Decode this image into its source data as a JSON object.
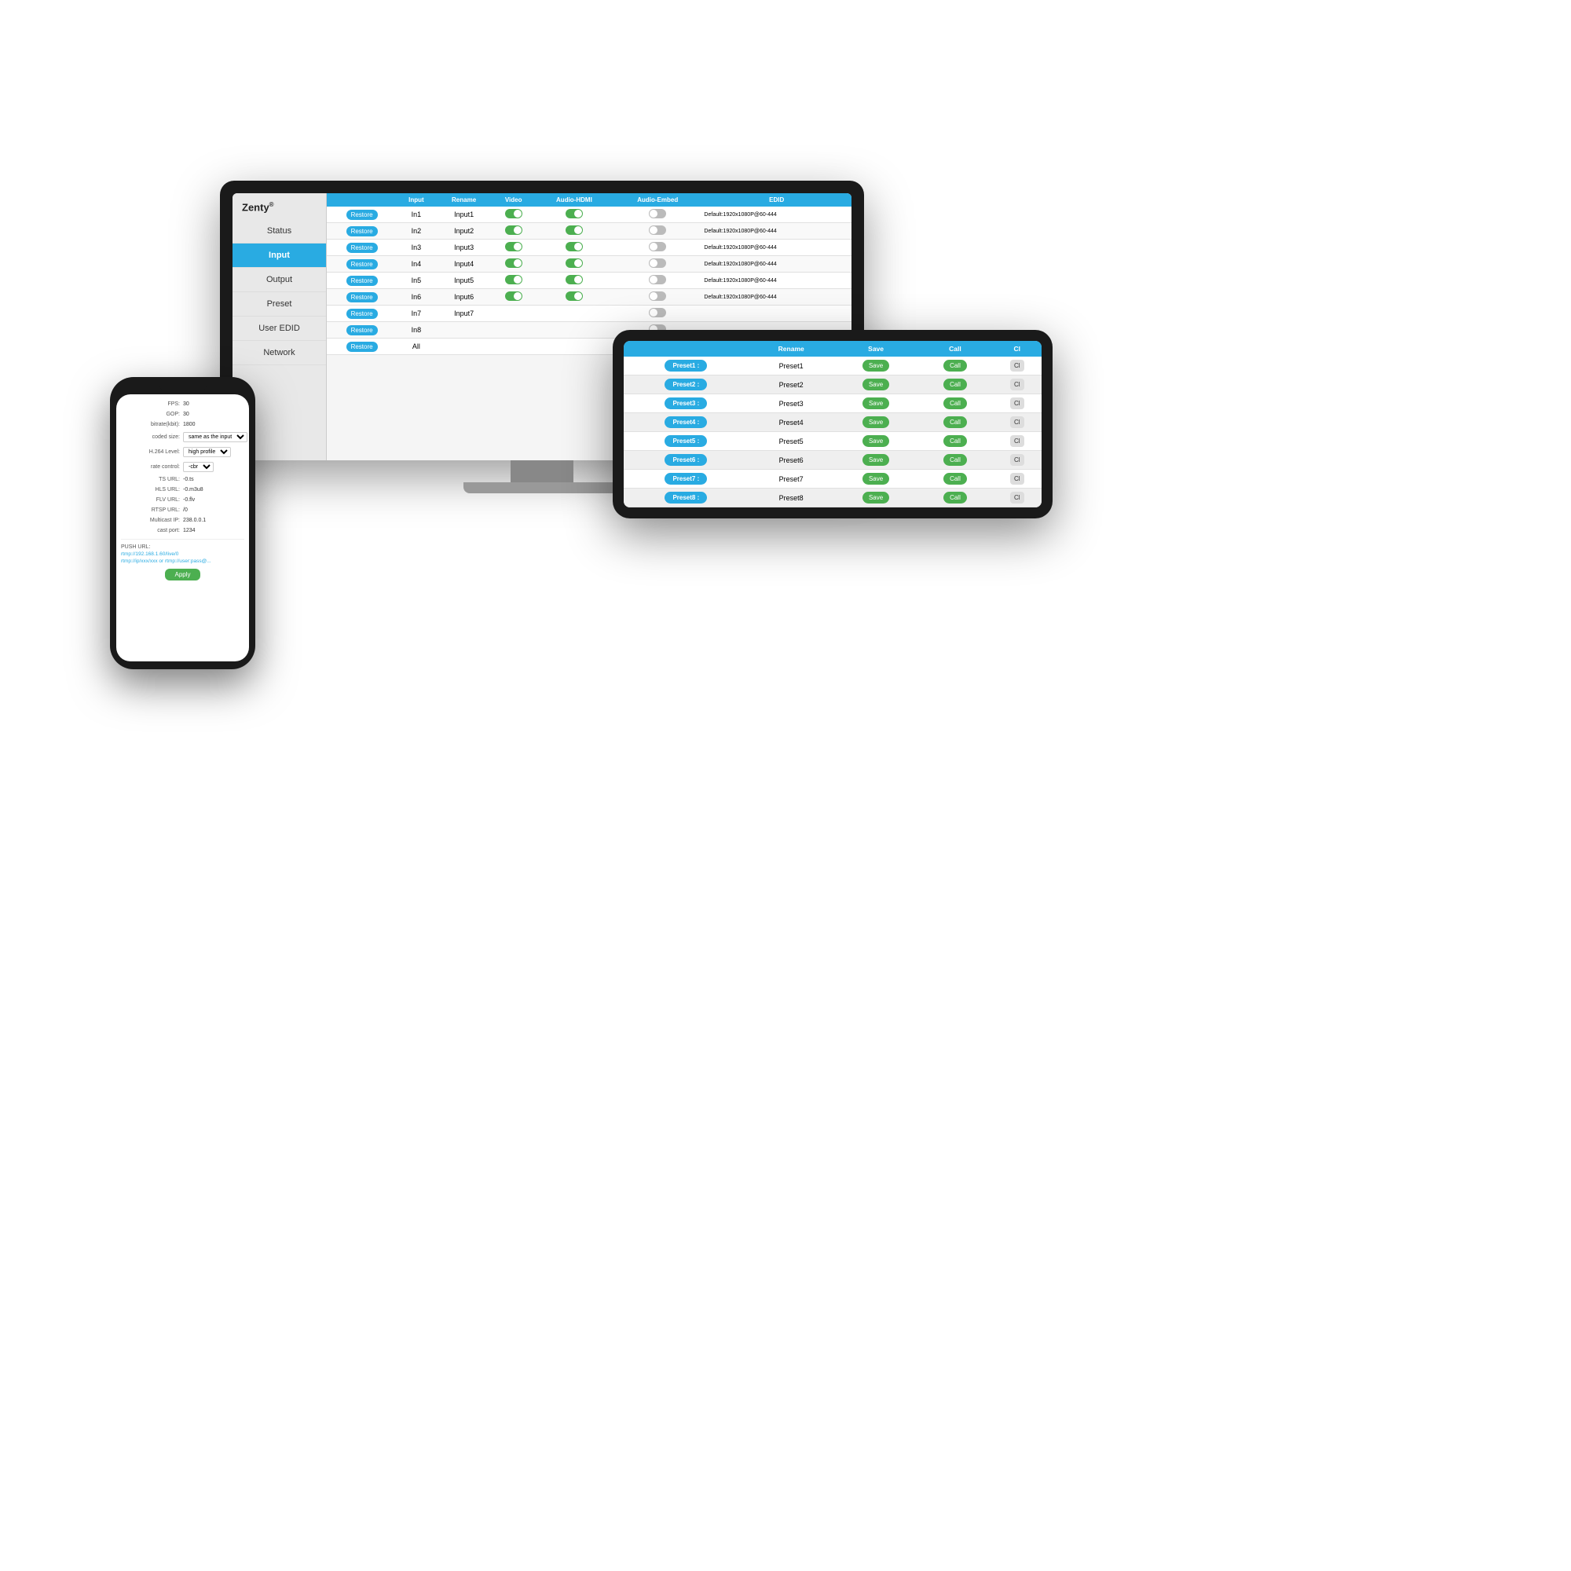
{
  "brand": {
    "name": "Zenty",
    "trademark": "®"
  },
  "monitor": {
    "sidebar": {
      "items": [
        {
          "label": "Status",
          "active": false
        },
        {
          "label": "Input",
          "active": true
        },
        {
          "label": "Output",
          "active": false
        },
        {
          "label": "Preset",
          "active": false
        },
        {
          "label": "User EDID",
          "active": false
        },
        {
          "label": "Network",
          "active": false
        }
      ]
    },
    "table": {
      "headers": [
        "",
        "Input",
        "Rename",
        "Video",
        "Audio-HDMI",
        "Audio-Embed",
        "EDID"
      ],
      "rows": [
        {
          "btn": "Restore",
          "input": "In1",
          "rename": "Input1",
          "video": true,
          "audioHdmi": true,
          "audioEmbed": false,
          "edid": "Default:1920x1080P@60-444"
        },
        {
          "btn": "Restore",
          "input": "In2",
          "rename": "Input2",
          "video": true,
          "audioHdmi": true,
          "audioEmbed": false,
          "edid": "Default:1920x1080P@60-444"
        },
        {
          "btn": "Restore",
          "input": "In3",
          "rename": "Input3",
          "video": true,
          "audioHdmi": true,
          "audioEmbed": false,
          "edid": "Default:1920x1080P@60-444"
        },
        {
          "btn": "Restore",
          "input": "In4",
          "rename": "Input4",
          "video": true,
          "audioHdmi": true,
          "audioEmbed": false,
          "edid": "Default:1920x1080P@60-444"
        },
        {
          "btn": "Restore",
          "input": "In5",
          "rename": "Input5",
          "video": true,
          "audioHdmi": true,
          "audioEmbed": false,
          "edid": "Default:1920x1080P@60-444"
        },
        {
          "btn": "Restore",
          "input": "In6",
          "rename": "Input6",
          "video": true,
          "audioHdmi": true,
          "audioEmbed": false,
          "edid": "Default:1920x1080P@60-444"
        },
        {
          "btn": "Restore",
          "input": "In7",
          "rename": "Input7",
          "video": false,
          "audioHdmi": false,
          "audioEmbed": false,
          "edid": ""
        },
        {
          "btn": "Restore",
          "input": "In8",
          "rename": "",
          "video": false,
          "audioHdmi": false,
          "audioEmbed": false,
          "edid": ""
        },
        {
          "btn": "Restore",
          "input": "All",
          "rename": "",
          "video": false,
          "audioHdmi": false,
          "audioEmbed": false,
          "edid": ""
        }
      ]
    }
  },
  "tablet": {
    "table": {
      "headers": [
        "",
        "Rename",
        "Save",
        "Call",
        "Cl"
      ],
      "rows": [
        {
          "label": "Preset1 :",
          "rename": "Preset1",
          "save": "Save",
          "call": "Call",
          "cl": "Cl"
        },
        {
          "label": "Preset2 :",
          "rename": "Preset2",
          "save": "Save",
          "call": "Call",
          "cl": "Cl"
        },
        {
          "label": "Preset3 :",
          "rename": "Preset3",
          "save": "Save",
          "call": "Call",
          "cl": "Cl"
        },
        {
          "label": "Preset4 :",
          "rename": "Preset4",
          "save": "Save",
          "call": "Call",
          "cl": "Cl"
        },
        {
          "label": "Preset5 :",
          "rename": "Preset5",
          "save": "Save",
          "call": "Call",
          "cl": "Cl"
        },
        {
          "label": "Preset6 :",
          "rename": "Preset6",
          "save": "Save",
          "call": "Call",
          "cl": "Cl"
        },
        {
          "label": "Preset7 :",
          "rename": "Preset7",
          "save": "Save",
          "call": "Call",
          "cl": "Cl"
        },
        {
          "label": "Preset8 :",
          "rename": "Preset8",
          "save": "Save",
          "call": "Call",
          "cl": "Cl"
        }
      ]
    }
  },
  "phone": {
    "fields": [
      {
        "label": "FPS:",
        "value": "30"
      },
      {
        "label": "GOP:",
        "value": "30"
      },
      {
        "label": "bitrate(kbit):",
        "value": "1800"
      },
      {
        "label": "coded size:",
        "value": "same as the input"
      },
      {
        "label": "H.264 Level:",
        "value": "high profile"
      },
      {
        "label": "rate control:",
        "value": "-cbr"
      },
      {
        "label": "TS URL:",
        "value": "-0.ts"
      },
      {
        "label": "HLS URL:",
        "value": "-0.m3u8"
      },
      {
        "label": "FLV URL:",
        "value": "-0.flv"
      },
      {
        "label": "RTSP URL:",
        "value": "/0"
      },
      {
        "label": "Multicast IP:",
        "value": "238.0.0.1"
      },
      {
        "label": "cast port:",
        "value": "1234"
      }
    ],
    "push_url_label": "PUSH URL:",
    "push_url_value": "rtmp://192.168.1.60/live/0",
    "push_url_placeholder": "rtmp://ip/xxx/xxx or rtmp://user:pass@...",
    "apply_button": "Apply"
  }
}
